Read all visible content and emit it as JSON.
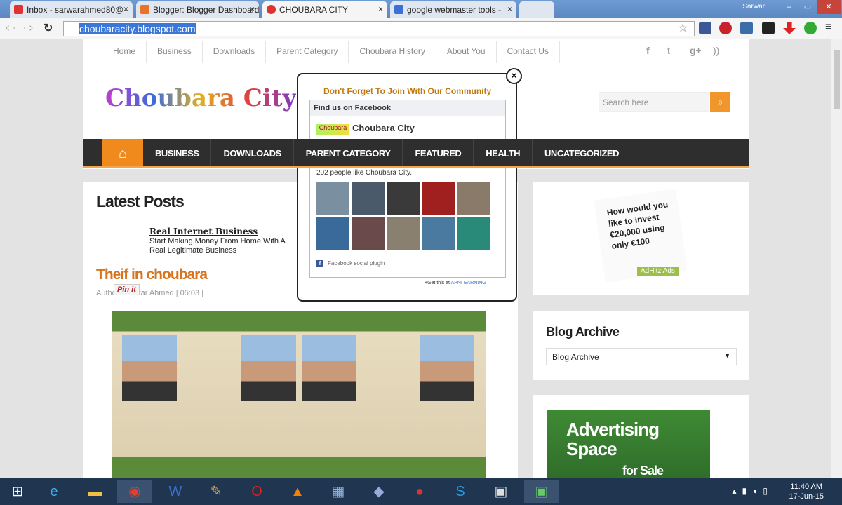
{
  "browser": {
    "tabs": [
      {
        "label": "Inbox - sarwarahmed80@",
        "icon": "gmail-icon",
        "color": "#d33"
      },
      {
        "label": "Blogger: Blogger Dashboard",
        "icon": "blogger-icon",
        "color": "#e8742a"
      },
      {
        "label": "CHOUBARA CITY",
        "icon": "choubara-icon",
        "color": "#d33"
      },
      {
        "label": "google webmaster tools -",
        "icon": "google-icon",
        "color": "#3a70d8"
      }
    ],
    "user": "Sarwar",
    "url": "choubaracity.blogspot.com"
  },
  "site": {
    "top_nav": [
      "Home",
      "Business",
      "Downloads",
      "Parent Category",
      "Choubara History",
      "About You",
      "Contact Us"
    ],
    "logo": "Choubara City",
    "search_placeholder": "Search here",
    "main_nav": [
      "BUSINESS",
      "DOWNLOADS",
      "PARENT CATEGORY",
      "FEATURED",
      "HEALTH",
      "UNCATEGORIZED"
    ]
  },
  "content": {
    "heading": "Latest Posts",
    "ad_title": "Real Internet Business",
    "ad_line1": "Start Making Money From Home With A",
    "ad_line2": "Real Legitimate Business",
    "post_title": "Theif in choubara",
    "post_meta": "Author: Sarwar Ahmed  |  05:03  |",
    "pin_it": "Pin it"
  },
  "sidebar": {
    "ad_text": "How would you like to invest €20,000 using only €100",
    "ad_tag": "AdHitz Ads",
    "archive_title": "Blog Archive",
    "archive_select": "Blog Archive",
    "adv_line1": "Advertising",
    "adv_line2": "Space",
    "adv_line3": "for Sale"
  },
  "popup": {
    "title": "Don't Forget To Join With Our Community",
    "fb_header": "Find us on Facebook",
    "fb_page": "Choubara City",
    "fb_logo": "Choubara",
    "fb_count": "202 people like Choubara City.",
    "fb_plugin": "Facebook social plugin",
    "get_this": "+Get this at",
    "get_this_link": "APNI EARNING",
    "close": "×"
  },
  "taskbar": {
    "time": "11:40 AM",
    "date": "17-Jun-15"
  }
}
